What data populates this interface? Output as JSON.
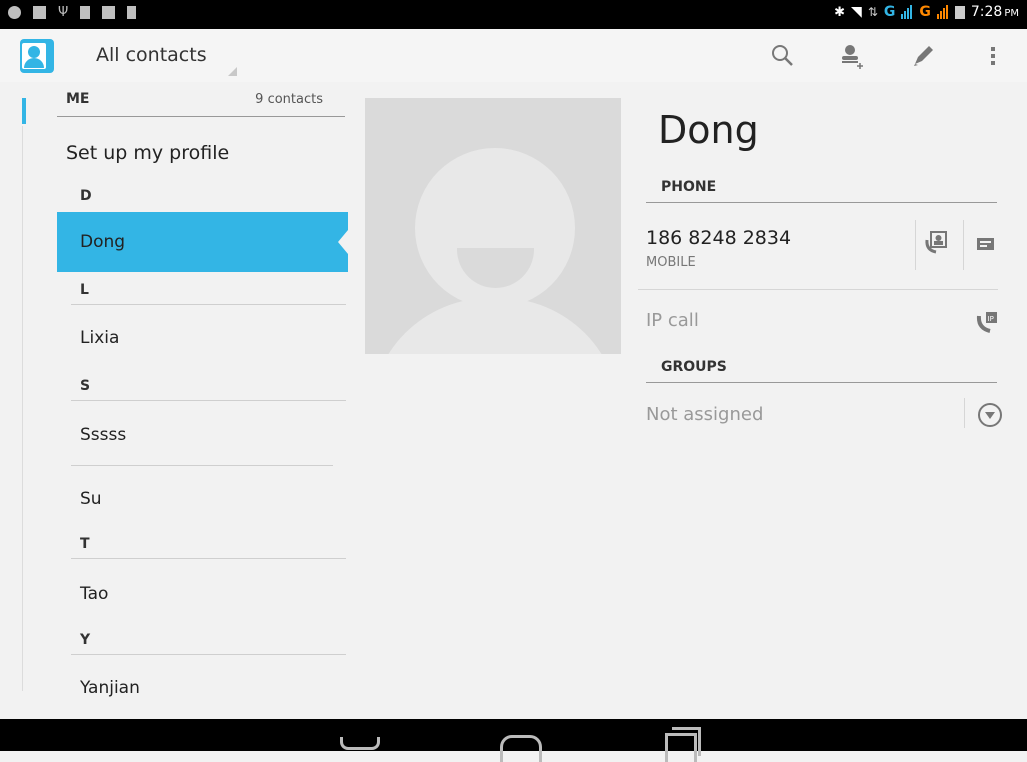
{
  "status_bar": {
    "time": "7:28",
    "ampm": "PM",
    "network_1": "G",
    "network_2": "G"
  },
  "action_bar": {
    "title": "All contacts",
    "icons": [
      "search-icon",
      "add-contact-icon",
      "edit-icon",
      "overflow-menu-icon"
    ]
  },
  "left_pane": {
    "me_header": "ME",
    "contact_count": "9 contacts",
    "profile_label": "Set up my profile",
    "sections": [
      {
        "letter": "D",
        "contacts": [
          "Dong"
        ]
      },
      {
        "letter": "L",
        "contacts": [
          "Lixia"
        ]
      },
      {
        "letter": "S",
        "contacts": [
          "Sssss",
          "Su"
        ]
      },
      {
        "letter": "T",
        "contacts": [
          "Tao"
        ]
      },
      {
        "letter": "Y",
        "contacts": [
          "Yanjian"
        ]
      }
    ],
    "selected_contact": "Dong"
  },
  "detail": {
    "name": "Dong",
    "phone_header": "PHONE",
    "phone_number": "186 8248 2834",
    "phone_type": "MOBILE",
    "ip_call_label": "IP call",
    "groups_header": "GROUPS",
    "groups_value": "Not assigned"
  },
  "colors": {
    "accent": "#33b5e5",
    "background": "#f2f2f2"
  }
}
